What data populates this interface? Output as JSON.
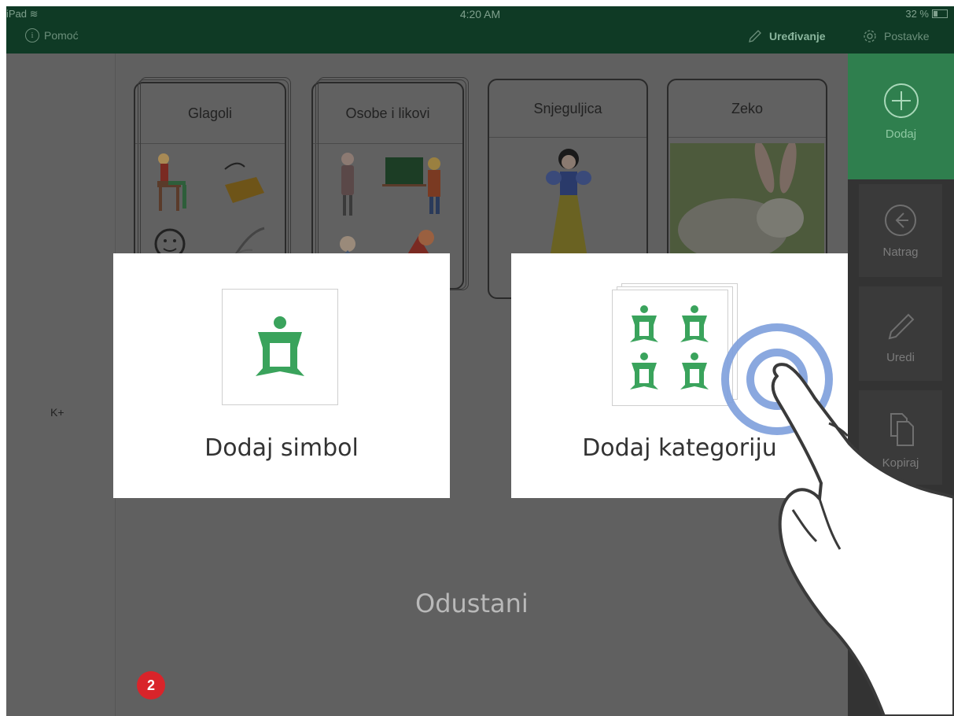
{
  "status_bar": {
    "device": "iPad",
    "time": "4:20 AM",
    "battery": "32 %"
  },
  "header": {
    "help_label": "Pomoć",
    "edit_label": "Uređivanje",
    "settings_label": "Postavke"
  },
  "left_panel": {
    "label": "K+"
  },
  "categories": [
    {
      "title": "Glagoli"
    },
    {
      "title": "Osobe i likovi"
    },
    {
      "title": "Snjeguljica"
    },
    {
      "title": "Zeko"
    }
  ],
  "toolbar": {
    "add_label": "Dodaj",
    "back_label": "Natrag",
    "edit_label": "Uredi",
    "copy_label": "Kopiraj"
  },
  "dialog": {
    "add_symbol_label": "Dodaj simbol",
    "add_category_label": "Dodaj kategoriju",
    "cancel_label": "Odustani"
  },
  "step_badge": "2",
  "colors": {
    "status_bar": "#0f3a25",
    "accent_green": "#2f7f4e",
    "symbol_green": "#3aa35c",
    "overlay": "#5e5e5e",
    "badge_red": "#d9242a",
    "touch_ring": "#7d9fdc"
  }
}
